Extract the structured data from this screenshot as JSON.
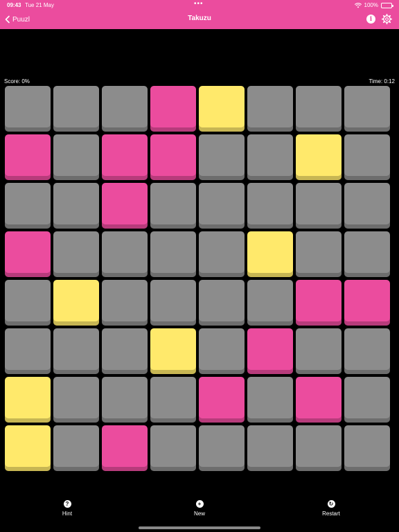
{
  "status_bar": {
    "time": "09:43",
    "date": "Tue 21 May",
    "dots": "•••",
    "battery": "100%"
  },
  "nav": {
    "back_label": "Puuzl",
    "title": "Takuzu",
    "info_label": "i"
  },
  "game": {
    "score": "Score: 0%",
    "time": "Time: 0:12",
    "grid": [
      [
        "g",
        "g",
        "g",
        "p",
        "y",
        "g",
        "g",
        "g"
      ],
      [
        "p",
        "g",
        "p",
        "p",
        "g",
        "g",
        "y",
        "g"
      ],
      [
        "g",
        "g",
        "p",
        "g",
        "g",
        "g",
        "g",
        "g"
      ],
      [
        "p",
        "g",
        "g",
        "g",
        "g",
        "y",
        "g",
        "g"
      ],
      [
        "g",
        "y",
        "g",
        "g",
        "g",
        "g",
        "p",
        "p"
      ],
      [
        "g",
        "g",
        "g",
        "y",
        "g",
        "p",
        "g",
        "g"
      ],
      [
        "y",
        "g",
        "g",
        "g",
        "p",
        "g",
        "p",
        "g"
      ],
      [
        "y",
        "g",
        "p",
        "g",
        "g",
        "g",
        "g",
        "g"
      ]
    ]
  },
  "toolbar": {
    "hint_label": "Hint",
    "new_label": "New",
    "restart_label": "Restart",
    "hint_icon": "?",
    "new_icon": "+",
    "restart_icon": "↻"
  },
  "colors": {
    "accent": "#EB4C9E",
    "tile_pink": "#EB4C9E",
    "tile_yellow": "#FFE96B",
    "tile_empty": "#8C8C8C"
  }
}
